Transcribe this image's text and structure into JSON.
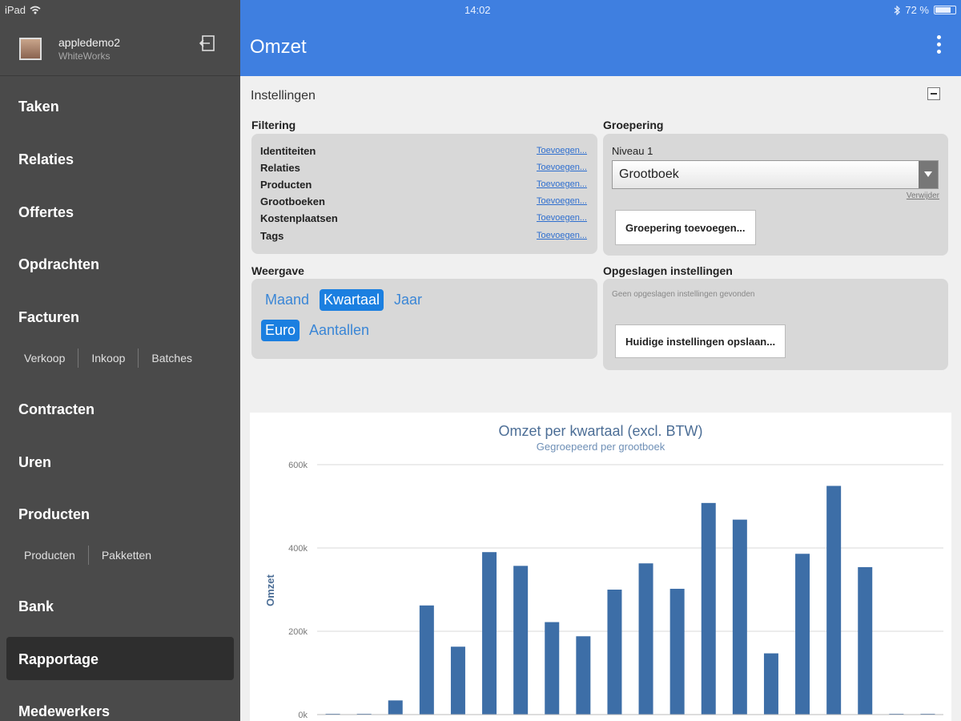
{
  "status": {
    "device": "iPad",
    "time": "14:02",
    "battery": "72 %"
  },
  "user": {
    "name": "appledemo2",
    "org": "WhiteWorks"
  },
  "nav": {
    "taken": "Taken",
    "relaties": "Relaties",
    "offertes": "Offertes",
    "opdrachten": "Opdrachten",
    "facturen": "Facturen",
    "verkoop": "Verkoop",
    "inkoop": "Inkoop",
    "batches": "Batches",
    "contracten": "Contracten",
    "uren": "Uren",
    "producten": "Producten",
    "sub_producten": "Producten",
    "pakketten": "Pakketten",
    "bank": "Bank",
    "rapportage": "Rapportage",
    "medewerkers": "Medewerkers"
  },
  "header": {
    "title": "Omzet"
  },
  "settings": {
    "title": "Instellingen",
    "filtering": {
      "heading": "Filtering",
      "rows": [
        {
          "label": "Identiteiten",
          "link": "Toevoegen..."
        },
        {
          "label": "Relaties",
          "link": "Toevoegen..."
        },
        {
          "label": "Producten",
          "link": "Toevoegen..."
        },
        {
          "label": "Grootboeken",
          "link": "Toevoegen..."
        },
        {
          "label": "Kostenplaatsen",
          "link": "Toevoegen..."
        },
        {
          "label": "Tags",
          "link": "Toevoegen..."
        }
      ]
    },
    "groepering": {
      "heading": "Groepering",
      "level": "Niveau 1",
      "selected": "Grootboek",
      "remove": "Verwijder",
      "add_button": "Groepering toevoegen..."
    },
    "weergave": {
      "heading": "Weergave",
      "maand": "Maand",
      "kwartaal": "Kwartaal",
      "jaar": "Jaar",
      "euro": "Euro",
      "aantallen": "Aantallen"
    },
    "opgeslagen": {
      "heading": "Opgeslagen instellingen",
      "empty": "Geen opgeslagen instellingen gevonden",
      "save_button": "Huidige instellingen opslaan..."
    }
  },
  "colors": {
    "accent": "#3f7fe0",
    "bar": "#3d6ea7",
    "sidebar": "#4a4a4a"
  },
  "chart_data": {
    "type": "bar",
    "title": "Omzet per kwartaal (excl. BTW)",
    "subtitle": "Gegroepeerd per grootboek",
    "ylabel": "Omzet",
    "ylim": [
      0,
      600000
    ],
    "yticks": [
      "0k",
      "200k",
      "400k",
      "600k"
    ],
    "values": [
      2000,
      2000,
      34000,
      262000,
      163000,
      390000,
      357000,
      222000,
      188000,
      300000,
      363000,
      302000,
      508000,
      468000,
      147000,
      386000,
      549000,
      354000,
      2000,
      2000
    ]
  }
}
